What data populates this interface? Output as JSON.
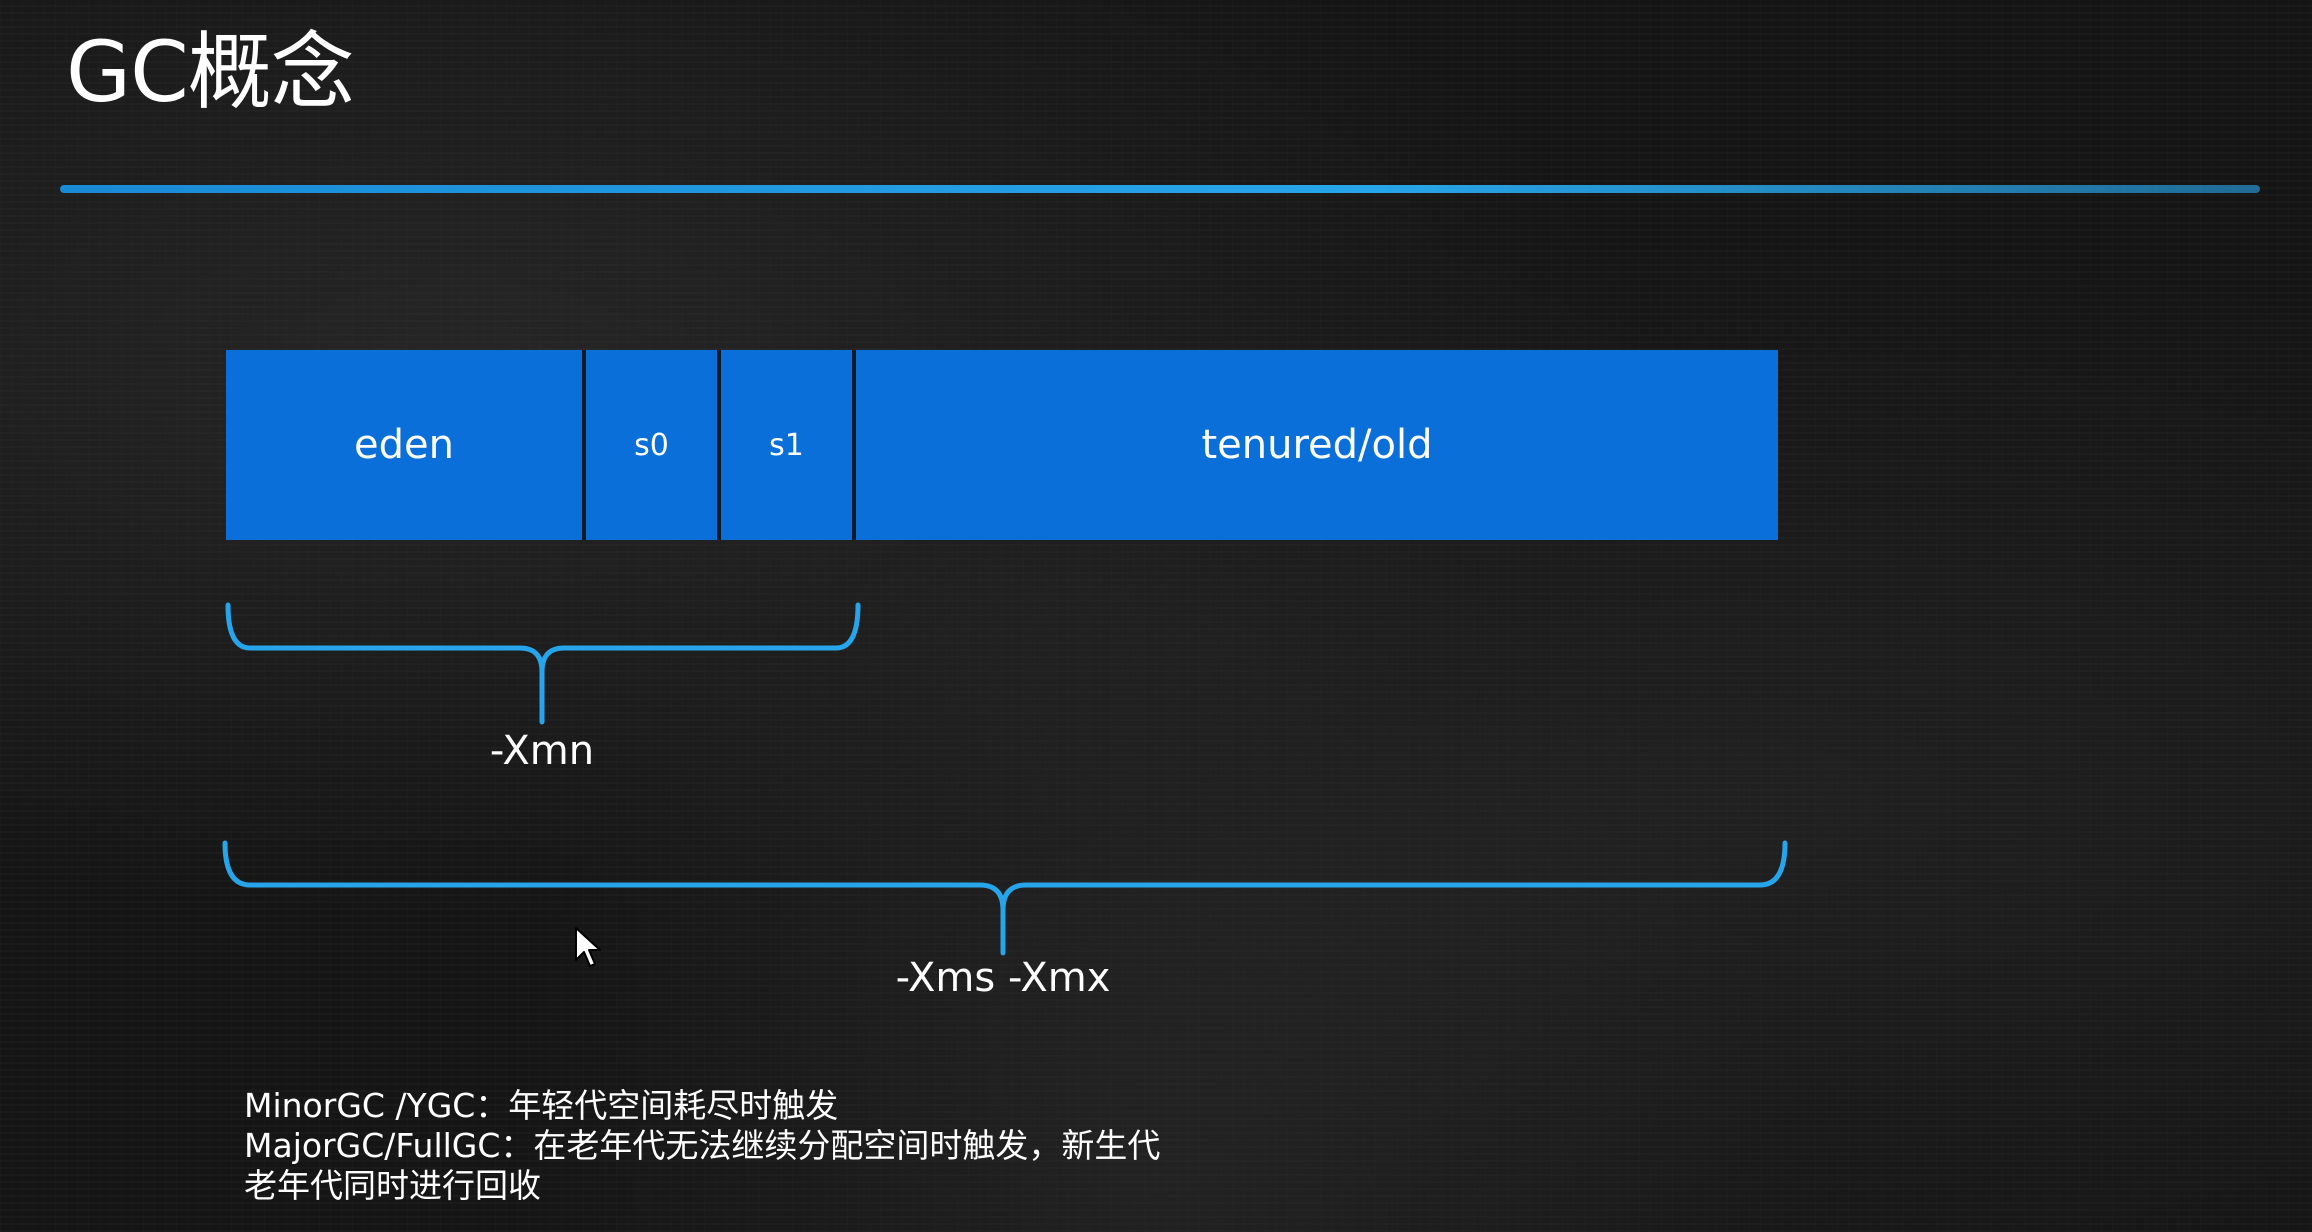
{
  "title": "GC概念",
  "heap": {
    "segments": [
      {
        "id": "eden",
        "label": "eden"
      },
      {
        "id": "s0",
        "label": "s0"
      },
      {
        "id": "s1",
        "label": "s1"
      },
      {
        "id": "old",
        "label": "tenured/old"
      }
    ]
  },
  "braces": {
    "young_label": "-Xmn",
    "heap_label": "-Xms -Xmx"
  },
  "notes": {
    "line1": "MinorGC /YGC：年轻代空间耗尽时触发",
    "line2": "MajorGC/FullGC：在老年代无法继续分配空间时触发，新生代",
    "line3": "老年代同时进行回收"
  },
  "colors": {
    "segment_fill": "#0a6fd8",
    "accent": "#27a5ea",
    "background": "#151515"
  }
}
